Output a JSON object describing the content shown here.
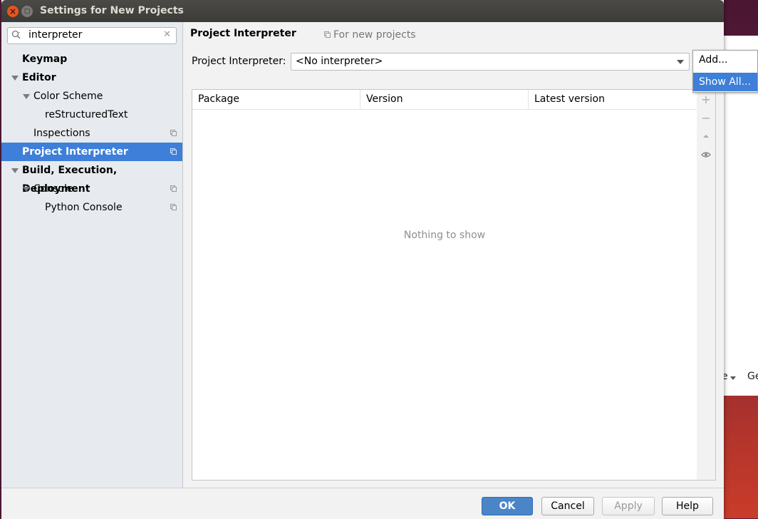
{
  "window": {
    "title": "Settings for New Projects"
  },
  "background_window": {
    "peek_text_1": "e",
    "peek_text_2": "Ge"
  },
  "sidebar": {
    "search_value": "interpreter",
    "items": [
      {
        "label": "Keymap"
      },
      {
        "label": "Editor"
      },
      {
        "label": "Color Scheme"
      },
      {
        "label": "reStructuredText"
      },
      {
        "label": "Inspections"
      },
      {
        "label": "Project Interpreter"
      },
      {
        "label": "Build, Execution, Deployment"
      },
      {
        "label": "Console"
      },
      {
        "label": "Python Console"
      }
    ]
  },
  "main": {
    "title": "Project Interpreter",
    "scope": "For new projects",
    "interpreter_label": "Project Interpreter:",
    "interpreter_value": "<No interpreter>",
    "table": {
      "columns": [
        "Package",
        "Version",
        "Latest version"
      ],
      "empty_text": "Nothing to show"
    }
  },
  "popup": {
    "items": [
      "Add...",
      "Show All..."
    ]
  },
  "footer": {
    "ok": "OK",
    "cancel": "Cancel",
    "apply": "Apply",
    "help": "Help"
  },
  "colors": {
    "selection": "#3d7fd9",
    "primary_button": "#4a86c7",
    "title_bar": "#3c3b37",
    "close_button": "#e95420"
  }
}
